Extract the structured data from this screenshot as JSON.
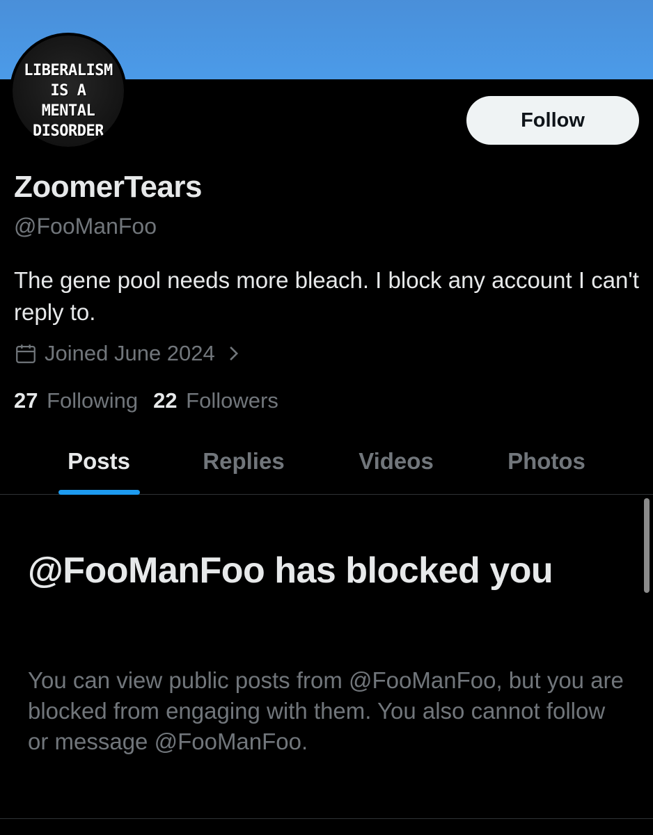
{
  "colors": {
    "banner": "#4b9be9",
    "background": "#000000",
    "primary_text": "#e7e9ea",
    "secondary_text": "#71767b",
    "accent": "#1d9bf0",
    "follow_button_bg": "#eff3f4"
  },
  "avatar": {
    "text": "LIBERALISM\nIS A\nMENTAL\nDISORDER"
  },
  "actions": {
    "follow_label": "Follow"
  },
  "profile": {
    "display_name": "ZoomerTears",
    "handle": "@FooManFoo",
    "bio": "The gene pool needs more bleach. I block any account I can't reply to.",
    "joined": "Joined June 2024",
    "joined_icon": "calendar-icon",
    "following_count": "27",
    "following_label": "Following",
    "followers_count": "22",
    "followers_label": "Followers"
  },
  "tabs": [
    {
      "label": "Posts",
      "active": true
    },
    {
      "label": "Replies",
      "active": false
    },
    {
      "label": "Videos",
      "active": false
    },
    {
      "label": "Photos",
      "active": false
    }
  ],
  "blocked": {
    "title": "@FooManFoo has blocked you",
    "description": "You can view public posts from @FooManFoo, but you are blocked from engaging with them. You also cannot follow or message @FooManFoo."
  }
}
